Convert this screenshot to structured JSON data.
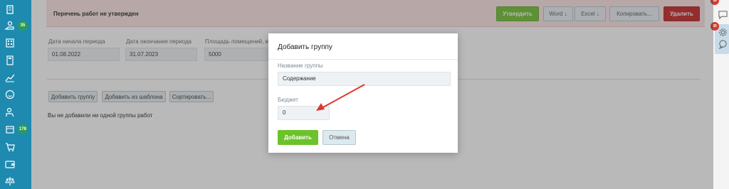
{
  "sidebar": {
    "icons": [
      "files-icon",
      "hand-coins-icon",
      "building-icon",
      "calculator-icon",
      "chart-icon",
      "smiley-icon",
      "worker-icon",
      "calendar-icon",
      "cart-icon",
      "wallet-icon",
      "scales-icon"
    ],
    "badges": [
      "35",
      "178"
    ],
    "accent": "#1e8ab0"
  },
  "header": {
    "status_title": "Перечень работ не утвержден",
    "approve_label": "Утвердить",
    "word_label": "Word ↓",
    "excel_label": "Excel ↓",
    "copy_label": "Копировать...",
    "delete_label": "Удалить"
  },
  "fields": {
    "start_label": "Дата начала периода",
    "start_value": "01.08.2022",
    "end_label": "Дата окончания периода",
    "end_value": "31.07.2023",
    "area_label": "Площадь помещений, м",
    "area_value": "5000"
  },
  "actions": {
    "add_group": "Добавить группу",
    "add_from_template": "Добавить из шаблона",
    "sort": "Сортировать..."
  },
  "empty_message": "Вы не добавили ни одной группы работ",
  "rail": {
    "badges": [
      "30",
      "30"
    ]
  },
  "modal": {
    "title": "Добавить группу",
    "name_label": "Название группы",
    "name_value": "Содержание",
    "budget_label": "Бюджет",
    "budget_value": "0",
    "add_button": "Добавить",
    "cancel_button": "Отмена"
  },
  "colors": {
    "approve": "#6cbf2a",
    "delete": "#c41d1d",
    "header_bg": "#fce3e3",
    "arrow": "#e0392b"
  }
}
